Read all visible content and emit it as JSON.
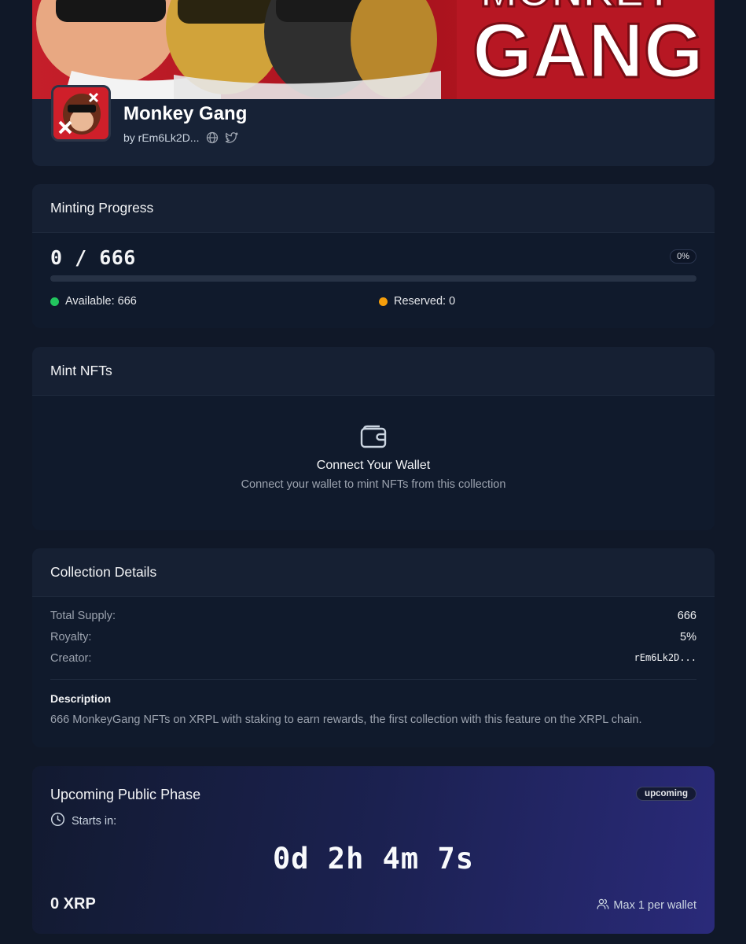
{
  "header": {
    "banner_text": "MONKEY GANG",
    "title": "Monkey Gang",
    "creator": "by rEm6Lk2D...",
    "icons": [
      "globe-icon",
      "twitter-icon"
    ]
  },
  "minting": {
    "heading": "Minting Progress",
    "count": "0 / 666",
    "percent": "0%",
    "progress_fraction": 0,
    "available": "Available: 666",
    "reserved": "Reserved: 0",
    "colors": {
      "available": "#22c55e",
      "reserved": "#f59e0b"
    }
  },
  "mint_nfts": {
    "heading": "Mint NFTs",
    "icon": "wallet-icon",
    "connect_title": "Connect Your Wallet",
    "connect_subtitle": "Connect your wallet to mint NFTs from this collection"
  },
  "details": {
    "heading": "Collection Details",
    "rows": [
      {
        "label": "Total Supply:",
        "value": "666"
      },
      {
        "label": "Royalty:",
        "value": "5%"
      },
      {
        "label": "Creator:",
        "value": "rEm6Lk2D..."
      }
    ],
    "description_title": "Description",
    "description": "666 MonkeyGang NFTs on XRPL with staking to earn rewards, the first collection with this feature on the XRPL chain."
  },
  "phase": {
    "title": "Upcoming Public Phase",
    "badge": "upcoming",
    "starts_label": "Starts in:",
    "countdown": "0d 2h 4m 7s",
    "price": "0 XRP",
    "max_per_wallet": "Max 1 per wallet",
    "icons": [
      "clock-icon",
      "users-icon"
    ]
  }
}
